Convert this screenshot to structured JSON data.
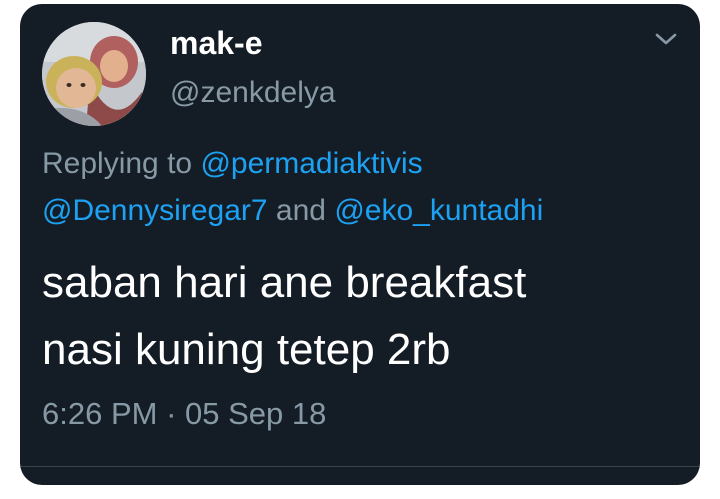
{
  "tweet": {
    "display_name": "mak-e",
    "handle": "@zenkdelya",
    "replying_to_label": "Replying to",
    "mention_1": "@permadiaktivis",
    "mention_2": "@Dennysiregar7",
    "mention_joiner": "and",
    "mention_3": "@eko_kuntadhi",
    "text_line_1": "saban hari ane breakfast",
    "text_line_2": "nasi kuning tetep 2rb",
    "time": "6:26 PM",
    "separator": "·",
    "date": "05 Sep 18"
  },
  "icons": {
    "avatar": "profile-photo",
    "menu": "chevron-down-icon"
  },
  "colors": {
    "background": "#141d26",
    "primary_text": "#ffffff",
    "secondary_text": "#8899a6",
    "link": "#1da1f2",
    "divider": "#38444d"
  }
}
